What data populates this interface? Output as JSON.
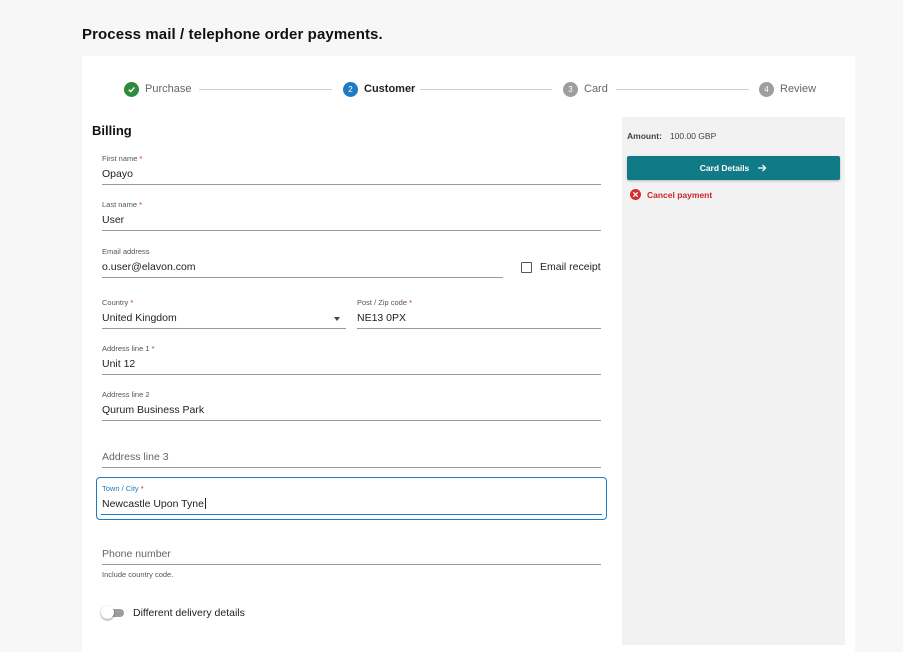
{
  "page": {
    "title": "Process mail / telephone order payments."
  },
  "stepper": {
    "steps": [
      {
        "number": "1",
        "label": "Purchase",
        "state": "done"
      },
      {
        "number": "2",
        "label": "Customer",
        "state": "current"
      },
      {
        "number": "3",
        "label": "Card",
        "state": "todo"
      },
      {
        "number": "4",
        "label": "Review",
        "state": "todo"
      }
    ]
  },
  "billing": {
    "title": "Billing",
    "first_name": {
      "label": "First name",
      "value": "Opayo",
      "required": true
    },
    "last_name": {
      "label": "Last name",
      "value": "User",
      "required": true
    },
    "email": {
      "label": "Email address",
      "value": "o.user@elavon.com"
    },
    "email_receipt": {
      "label": "Email receipt",
      "checked": false
    },
    "country": {
      "label": "Country",
      "value": "United Kingdom",
      "required": true
    },
    "postcode": {
      "label": "Post / Zip code",
      "value": "NE13 0PX",
      "required": true
    },
    "address1": {
      "label": "Address line 1",
      "value": "Unit 12",
      "required": true
    },
    "address2": {
      "label": "Address line 2",
      "value": "Qurum Business Park"
    },
    "address3": {
      "placeholder": "Address line 3",
      "value": ""
    },
    "town": {
      "label": "Town / City",
      "value": "Newcastle Upon Tyne",
      "required": true
    },
    "phone": {
      "placeholder": "Phone number",
      "helper": "Include country code.",
      "value": ""
    },
    "delivery_toggle": {
      "label": "Different delivery details",
      "on": false
    }
  },
  "summary": {
    "amount_label": "Amount:",
    "amount_value": "100.00 GBP",
    "card_details_button": "Card Details",
    "cancel_label": "Cancel payment"
  },
  "colors": {
    "primary_teal": "#107a87",
    "step_done": "#2e8b3e",
    "step_current": "#1f7bc1",
    "error_red": "#c62828",
    "focus_blue": "#1f7bc1"
  }
}
